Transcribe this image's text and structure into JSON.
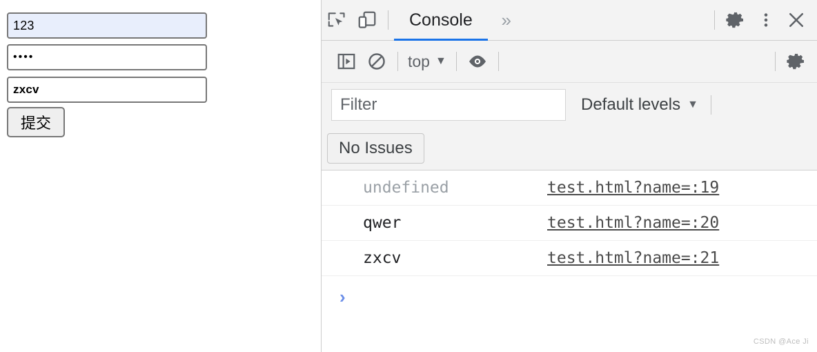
{
  "page_form": {
    "name_input": {
      "value": "123",
      "placeholder": ""
    },
    "password_input": {
      "value": "••••",
      "placeholder": ""
    },
    "other_input": {
      "value": "zxcv",
      "placeholder": ""
    },
    "submit_label": "提交"
  },
  "devtools": {
    "tabbar": {
      "inspect_icon": "inspect-element-icon",
      "device_icon": "device-toolbar-icon",
      "active_tab": "Console",
      "more_tabs": "»",
      "settings_icon": "gear-icon",
      "more_options_icon": "kebab-menu-icon",
      "close_icon": "close-icon",
      "active_tab_color": "#1a73e8"
    },
    "console_toolbar": {
      "sidebar_toggle_icon": "console-sidebar-icon",
      "clear_console_icon": "clear-console-icon",
      "context_label": "top",
      "context_caret": "▼",
      "live_expression_icon": "eye-icon",
      "settings_icon": "gear-icon"
    },
    "filter_bar": {
      "filter_placeholder": "Filter",
      "filter_value": "",
      "levels_label": "Default levels",
      "levels_caret": "▼"
    },
    "issues_bar": {
      "no_issues_label": "No Issues"
    },
    "log": {
      "rows": [
        {
          "message": "undefined",
          "muted": true,
          "source": "test.html?name=:19"
        },
        {
          "message": "qwer",
          "muted": false,
          "source": "test.html?name=:20"
        },
        {
          "message": "zxcv",
          "muted": false,
          "source": "test.html?name=:21"
        }
      ]
    },
    "prompt": {
      "caret": "›",
      "value": "",
      "caret_color": "#6b8ee8"
    }
  },
  "watermark": "CSDN @Ace Ji"
}
